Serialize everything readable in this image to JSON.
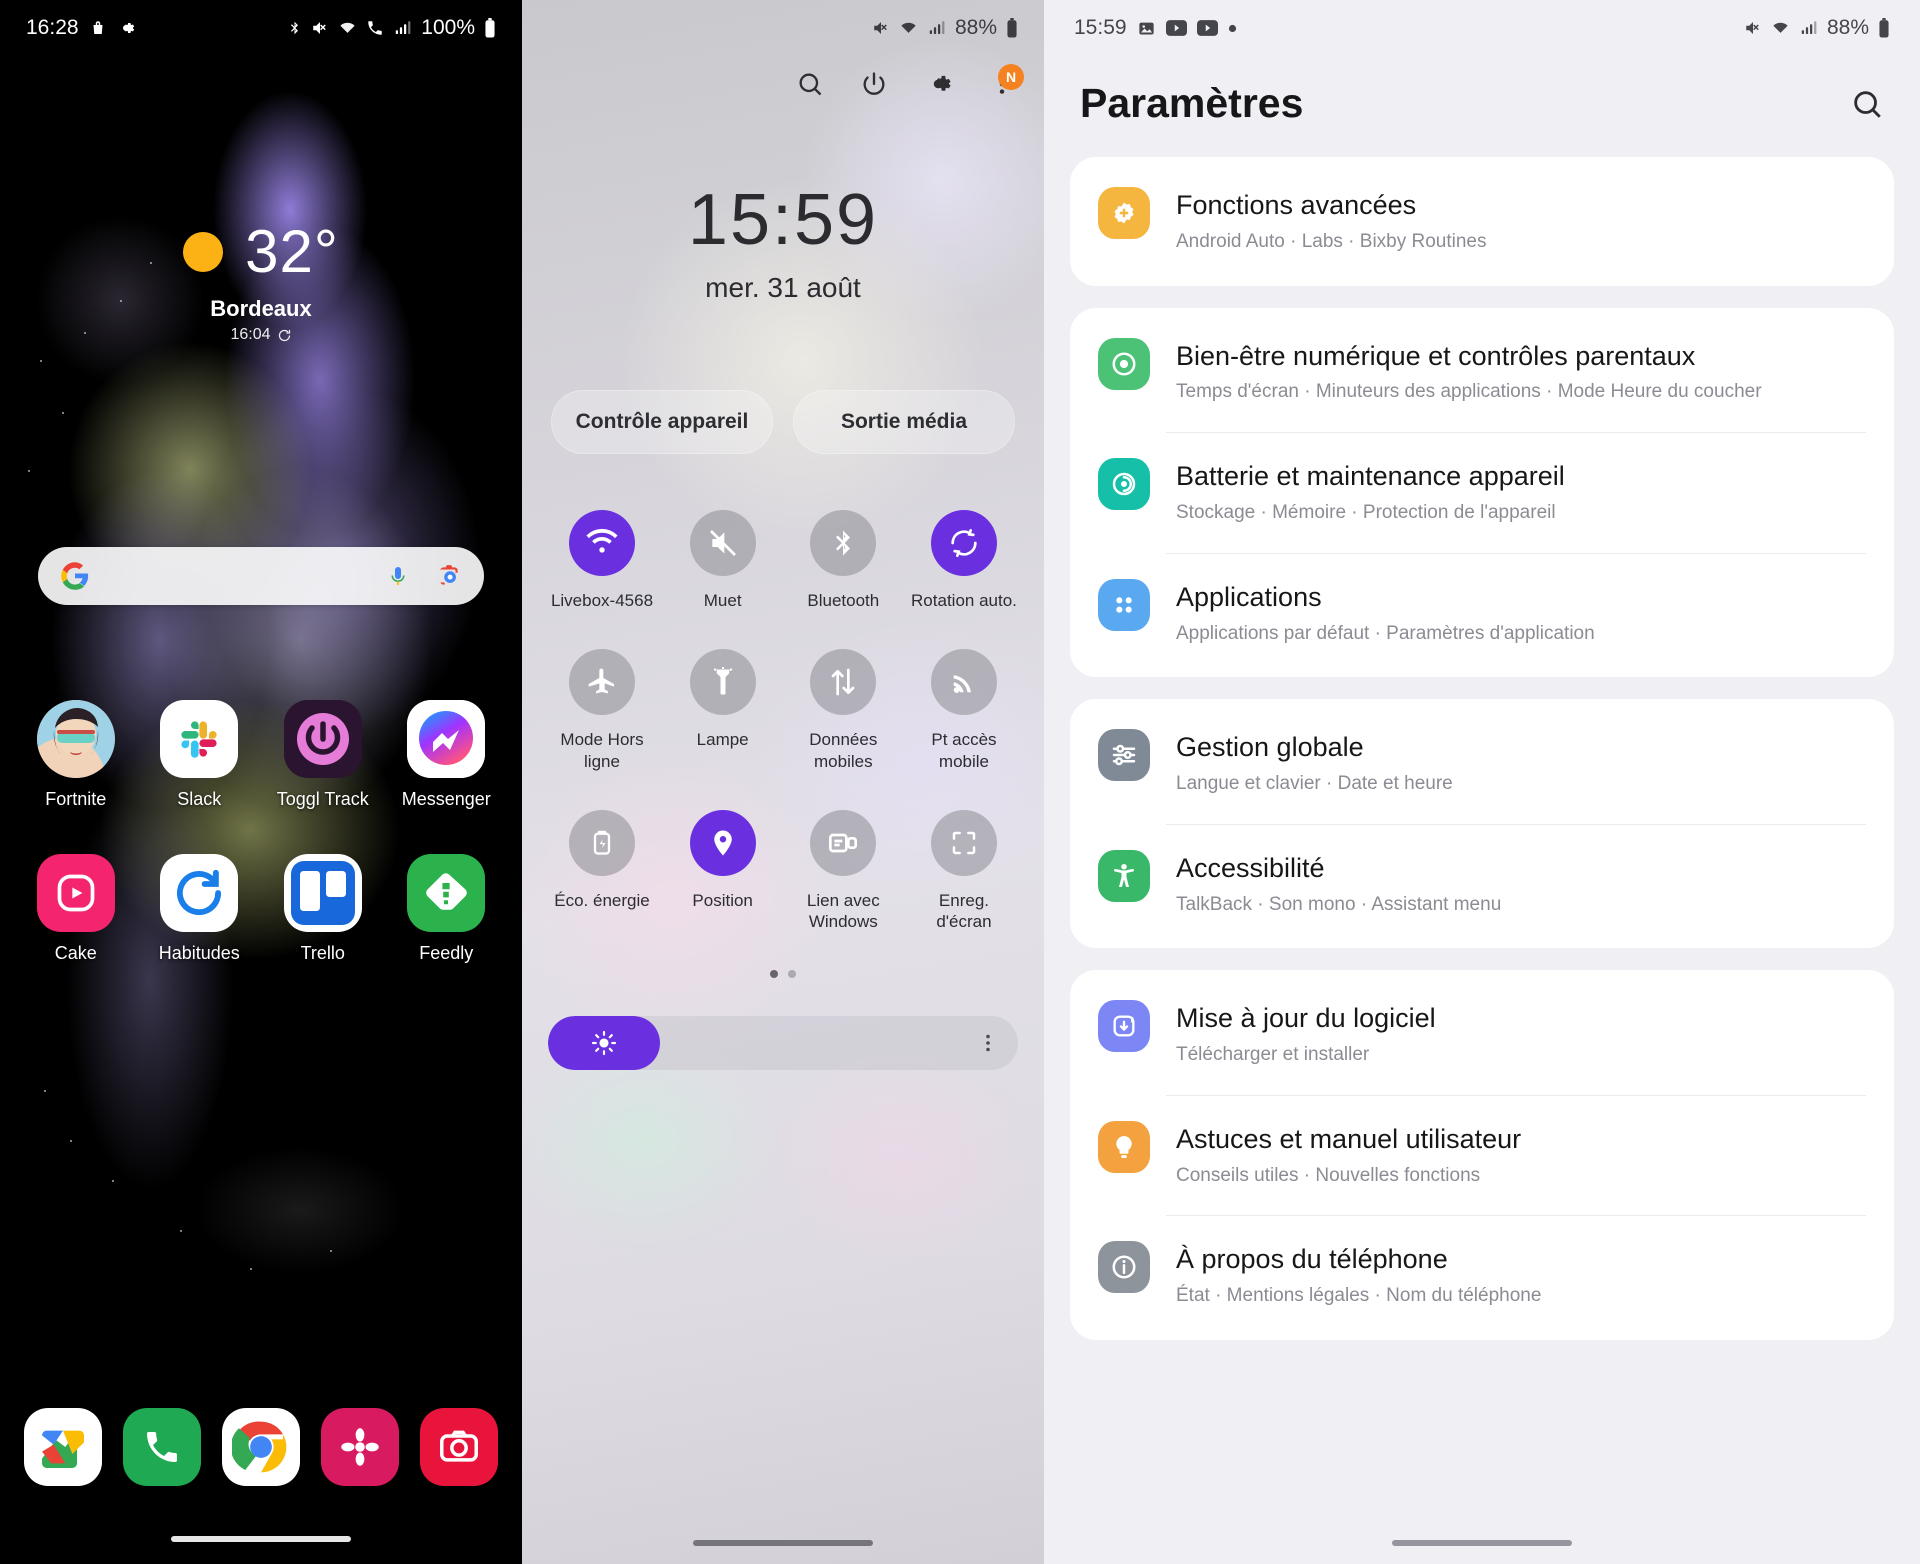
{
  "home": {
    "status_bar": {
      "time": "16:28",
      "left_icons": [
        "shopping-bag-icon",
        "gear-icon"
      ],
      "right_icons": [
        "bluetooth-icon",
        "mute-icon",
        "wifi-icon",
        "call-icon",
        "signal-icon"
      ],
      "battery_percent": "100%"
    },
    "weather": {
      "temperature": "32°",
      "city": "Bordeaux",
      "updated": "16:04",
      "condition_icon": "sun-icon"
    },
    "search": {
      "placeholder": "",
      "google_icon": "google-g-icon",
      "mic_icon": "microphone-icon",
      "lens_icon": "google-lens-icon"
    },
    "apps_row1": [
      {
        "label": "Fortnite",
        "icon": "fortnite-icon"
      },
      {
        "label": "Slack",
        "icon": "slack-icon"
      },
      {
        "label": "Toggl Track",
        "icon": "toggl-track-icon"
      },
      {
        "label": "Messenger",
        "icon": "messenger-icon"
      }
    ],
    "apps_row2": [
      {
        "label": "Cake",
        "icon": "cake-icon"
      },
      {
        "label": "Habitudes",
        "icon": "habitudes-icon"
      },
      {
        "label": "Trello",
        "icon": "trello-icon"
      },
      {
        "label": "Feedly",
        "icon": "feedly-icon"
      }
    ],
    "dock": [
      {
        "label": "Maps",
        "icon": "google-maps-icon"
      },
      {
        "label": "Téléphone",
        "icon": "phone-icon"
      },
      {
        "label": "Chrome",
        "icon": "chrome-icon"
      },
      {
        "label": "Photos",
        "icon": "flower-app-icon"
      },
      {
        "label": "Appareil photo",
        "icon": "camera-icon"
      }
    ]
  },
  "quick_settings": {
    "status_bar": {
      "right_icons": [
        "mute-icon",
        "wifi-icon",
        "signal-icon"
      ],
      "battery_percent": "88%"
    },
    "toolbar": {
      "search_icon": "search-icon",
      "power_icon": "power-icon",
      "settings_icon": "gear-icon",
      "more_icon": "more-vertical-icon",
      "avatar_badge": "N"
    },
    "clock": {
      "time": "15:59",
      "date": "mer. 31 août"
    },
    "pills": [
      {
        "label": "Contrôle appareil"
      },
      {
        "label": "Sortie média"
      }
    ],
    "tiles": [
      {
        "label": "Livebox-4568",
        "icon": "wifi-icon",
        "state": "on"
      },
      {
        "label": "Muet",
        "icon": "mute-icon",
        "state": "off"
      },
      {
        "label": "Bluetooth",
        "icon": "bluetooth-icon",
        "state": "off"
      },
      {
        "label": "Rotation auto.",
        "icon": "auto-rotate-icon",
        "state": "on"
      },
      {
        "label": "Mode Hors ligne",
        "icon": "airplane-icon",
        "state": "off"
      },
      {
        "label": "Lampe",
        "icon": "flashlight-icon",
        "state": "off"
      },
      {
        "label": "Données mobiles",
        "icon": "mobile-data-icon",
        "state": "off"
      },
      {
        "label": "Pt accès mobile",
        "icon": "hotspot-icon",
        "state": "off"
      },
      {
        "label": "Éco. énergie",
        "icon": "power-saving-icon",
        "state": "off"
      },
      {
        "label": "Position",
        "icon": "location-pin-icon",
        "state": "on"
      },
      {
        "label": "Lien avec Windows",
        "icon": "link-windows-icon",
        "state": "off"
      },
      {
        "label": "Enreg. d'écran",
        "icon": "screen-record-icon",
        "state": "off"
      }
    ],
    "page_dots": 2,
    "active_dot": 1,
    "brightness": {
      "icon": "brightness-icon",
      "more_icon": "more-vertical-icon",
      "level_percent": 24
    }
  },
  "settings": {
    "status_bar": {
      "time": "15:59",
      "left_icons": [
        "image-icon",
        "youtube-icon",
        "youtube-icon",
        "dot-icon"
      ],
      "right_icons": [
        "mute-icon",
        "wifi-icon",
        "signal-icon"
      ],
      "battery_percent": "88%"
    },
    "title": "Paramètres",
    "search_icon": "search-icon",
    "groups": [
      {
        "items": [
          {
            "title": "Fonctions avancées",
            "subtitle": "Android Auto  ·  Labs  ·  Bixby Routines",
            "icon": "advanced-features-icon",
            "color": "#f4b63f"
          }
        ]
      },
      {
        "items": [
          {
            "title": "Bien-être numérique et contrôles parentaux",
            "subtitle": "Temps d'écran  ·  Minuteurs des applications  ·  Mode Heure du coucher",
            "icon": "digital-wellbeing-icon",
            "color": "#4cc277"
          },
          {
            "title": "Batterie et maintenance appareil",
            "subtitle": "Stockage  ·  Mémoire  ·  Protection de l'appareil",
            "icon": "battery-care-icon",
            "color": "#16c0a8"
          },
          {
            "title": "Applications",
            "subtitle": "Applications par défaut  ·  Paramètres d'application",
            "icon": "apps-icon",
            "color": "#5aa9f0"
          }
        ]
      },
      {
        "items": [
          {
            "title": "Gestion globale",
            "subtitle": "Langue et clavier  ·  Date et heure",
            "icon": "general-management-icon",
            "color": "#7f8a96"
          },
          {
            "title": "Accessibilité",
            "subtitle": "TalkBack  ·  Son mono  ·  Assistant menu",
            "icon": "accessibility-icon",
            "color": "#39b869"
          }
        ]
      },
      {
        "items": [
          {
            "title": "Mise à jour du logiciel",
            "subtitle": "Télécharger et installer",
            "icon": "software-update-icon",
            "color": "#7d86f5"
          },
          {
            "title": "Astuces et manuel utilisateur",
            "subtitle": "Conseils utiles  ·  Nouvelles fonctions",
            "icon": "tips-icon",
            "color": "#f4a23f"
          },
          {
            "title": "À propos du téléphone",
            "subtitle": "État  ·  Mentions légales  ·  Nom du téléphone",
            "icon": "about-phone-icon",
            "color": "#8e949c"
          }
        ]
      }
    ]
  },
  "colors": {
    "accent_purple": "#6a30e0",
    "settings_bg": "#f0eff4",
    "card_bg": "#ffffff",
    "sun_yellow": "#fcb215"
  }
}
